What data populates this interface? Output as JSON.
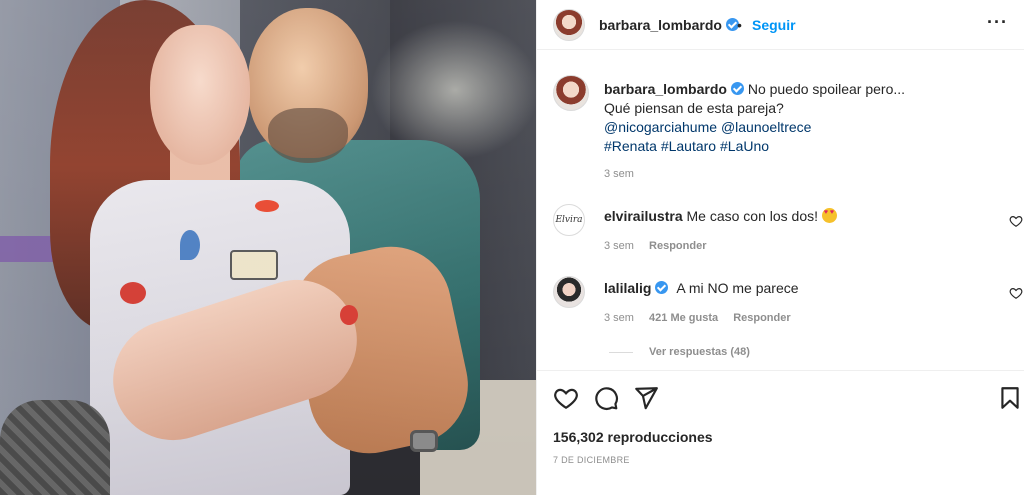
{
  "post": {
    "username": "barbara_lombardo",
    "separator": "•",
    "follow_label": "Seguir",
    "more_label": "···"
  },
  "caption": {
    "username": "barbara_lombardo",
    "line1": "No puedo spoilear pero...",
    "line2": "Qué piensan de esta pareja?",
    "mention1": "@nicogarciahume",
    "mention2": "@launoeltrece",
    "tag1": "#Renata",
    "tag2": "#Lautaro",
    "tag3": "#LaUno",
    "time": "3 sem"
  },
  "comments": [
    {
      "username": "elvirailustra",
      "avatar_text": "Elvira",
      "text": "Me caso con los dos!",
      "emoji": "smiling-face-with-heart-eyes",
      "time": "3 sem",
      "reply_label": "Responder"
    },
    {
      "username": "lalilalig",
      "text": "A mi NO me parece",
      "time": "3 sem",
      "likes": "421 Me gusta",
      "reply_label": "Responder"
    }
  ],
  "view_replies_label": "Ver respuestas (48)",
  "actions": {
    "icons": [
      "heart-icon",
      "comment-icon",
      "share-icon",
      "bookmark-icon"
    ],
    "views": "156,302 reproducciones",
    "date": "7 DE DICIEMBRE"
  },
  "colors": {
    "link": "#00376b",
    "follow": "#0095f6",
    "verified": "#3897f0",
    "muted": "#8e8e8e"
  }
}
